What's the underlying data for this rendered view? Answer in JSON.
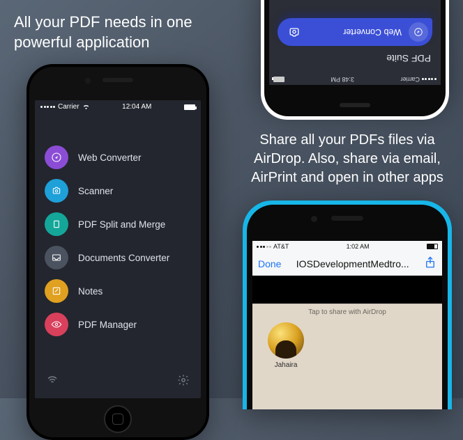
{
  "left_heading": "All your PDF needs in one powerful application",
  "right_heading": "Share all your PDFs files via AirDrop. Also, share via email, AirPrint and open in other apps",
  "phone_left": {
    "status": {
      "carrier": "Carrier",
      "time": "12:04 AM"
    },
    "menu": [
      {
        "label": "Web Converter"
      },
      {
        "label": "Scanner"
      },
      {
        "label": "PDF Split and Merge"
      },
      {
        "label": "Documents Converter"
      },
      {
        "label": "Notes"
      },
      {
        "label": "PDF Manager"
      }
    ]
  },
  "phone_top_right": {
    "status": {
      "carrier": "Carrier",
      "time": "3:48 PM"
    },
    "title": "PDF Suite",
    "item_label": "Web Converter"
  },
  "phone_bottom_right": {
    "status": {
      "carrier": "AT&T",
      "time": "1:02 AM"
    },
    "nav": {
      "done": "Done",
      "title": "IOSDevelopmentMedtro..."
    },
    "sheet_label": "Tap to share with AirDrop",
    "contact_name": "Jahaira"
  }
}
